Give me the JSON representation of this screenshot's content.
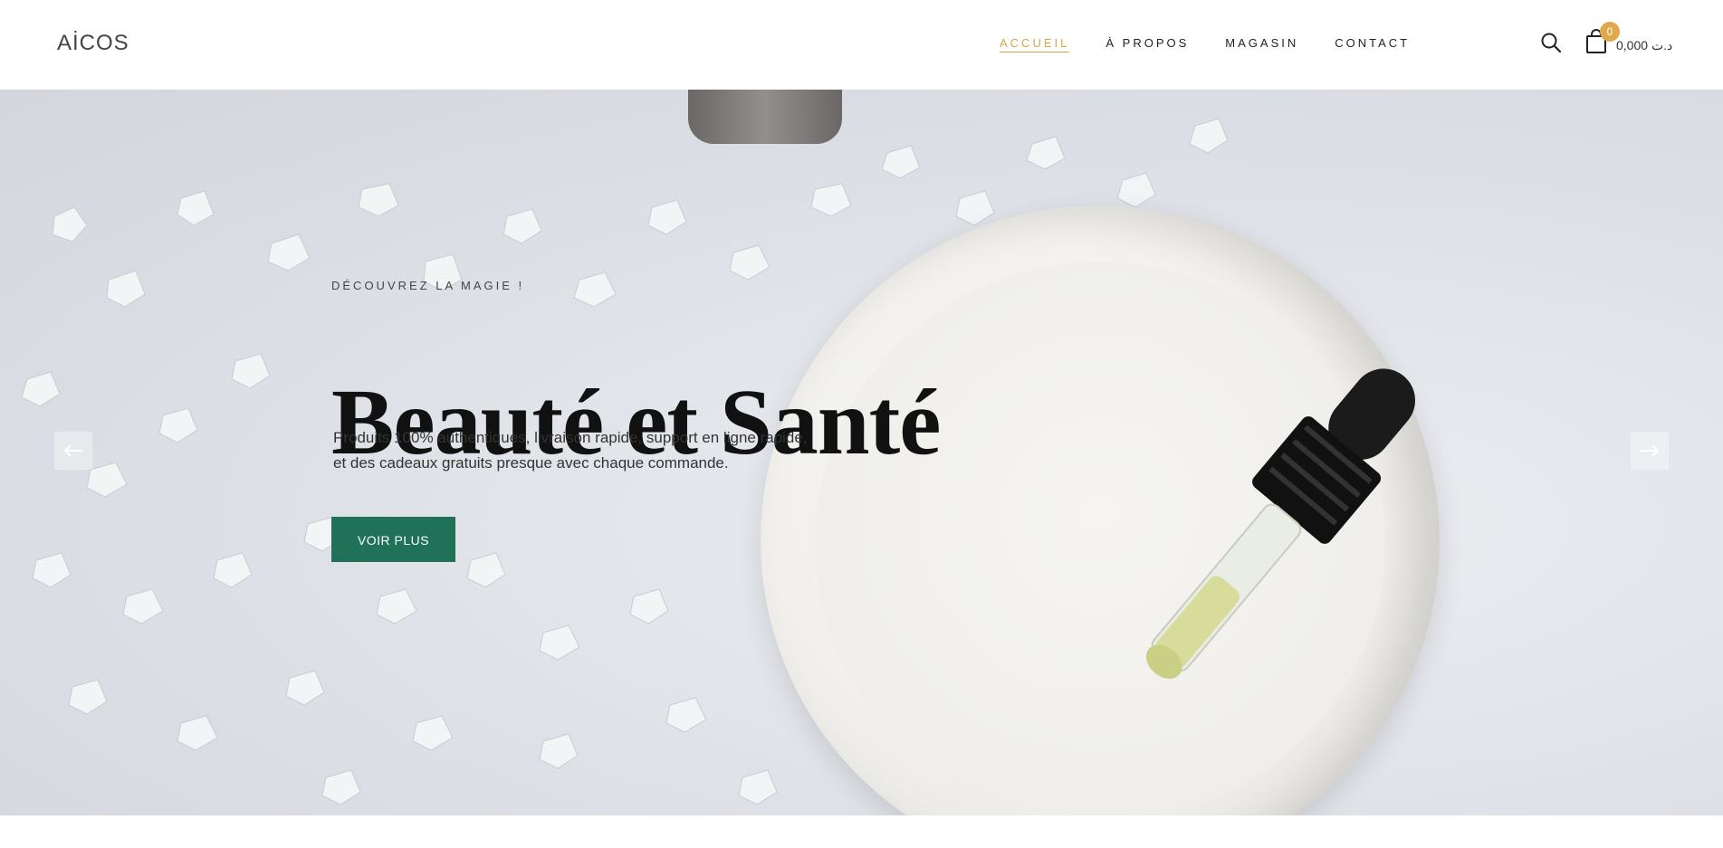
{
  "brand": {
    "logo_text": "AİCOS"
  },
  "nav": {
    "items": [
      {
        "label": "ACCUEIL",
        "active": true
      },
      {
        "label": "À PROPOS",
        "active": false
      },
      {
        "label": "MAGASIN",
        "active": false
      },
      {
        "label": "CONTACT",
        "active": false
      }
    ]
  },
  "header_actions": {
    "search_icon": "search-icon",
    "cart_icon": "shopping-bag-icon",
    "cart_count": "0",
    "cart_total": "0,000 د.ت"
  },
  "hero": {
    "eyebrow": "DÉCOUVREZ LA MAGIE !",
    "headline": "Beauté et Santé",
    "description_line1": "Produits 100% authentiques, livraison rapide, support en ligne rapide,",
    "description_line2": "et des cadeaux gratuits presque avec chaque commande.",
    "cta_label": "VOIR PLUS",
    "prev_icon": "arrow-left-icon",
    "next_icon": "arrow-right-icon"
  },
  "colors": {
    "accent": "#d8a54a",
    "button": "#1f7157",
    "badge": "#e0a84a"
  }
}
